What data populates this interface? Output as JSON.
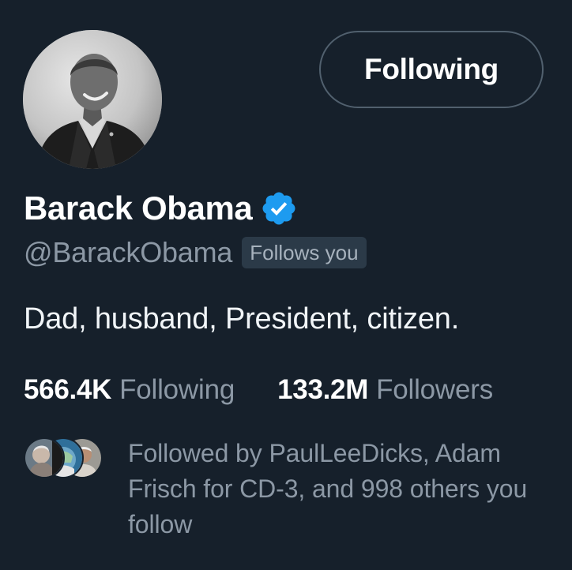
{
  "profile": {
    "name": "Barack Obama",
    "handle": "@BarackObama",
    "follows_you": "Follows you",
    "bio": "Dad, husband, President, citizen.",
    "verified_icon": "verified-badge-icon",
    "verified_color": "#1d9bf0"
  },
  "actions": {
    "follow_button_label": "Following"
  },
  "stats": {
    "following_count": "566.4K",
    "following_label": "Following",
    "followers_count": "133.2M",
    "followers_label": "Followers"
  },
  "followed_by": {
    "text": "Followed by PaulLeeDicks, Adam Frisch for CD-3, and 998 others you follow"
  },
  "colors": {
    "background": "#16202b",
    "text_primary": "#ffffff",
    "text_secondary": "#8c98a5",
    "button_border": "#51606e",
    "badge_bg": "#2b3a48"
  }
}
